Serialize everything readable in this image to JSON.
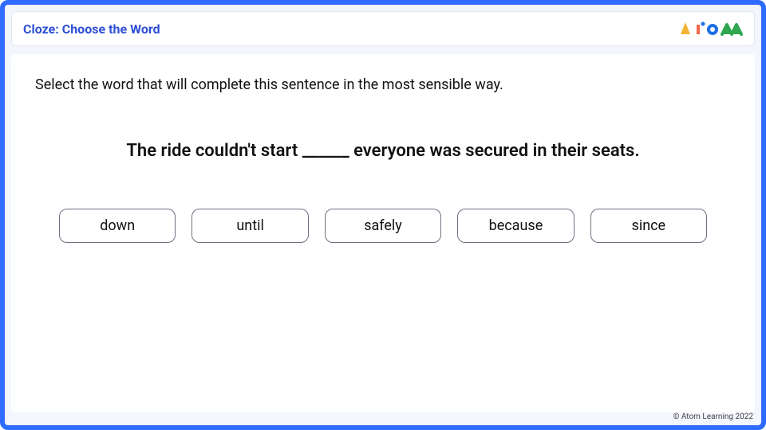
{
  "header": {
    "title": "Cloze: Choose the Word"
  },
  "instruction": "Select the word that will complete this sentence in the most sensible way.",
  "sentence": "The ride couldn't start ______ everyone was secured in their seats.",
  "options": [
    "down",
    "until",
    "safely",
    "because",
    "since"
  ],
  "copyright": "© Atom Learning 2022",
  "logo": {
    "colors": {
      "triangle": "#f2b233",
      "circle_small": "#1f6fe5",
      "bar": "#f06a4a",
      "circle_large": "#1f6fe5",
      "zig": "#2fa64f"
    }
  }
}
